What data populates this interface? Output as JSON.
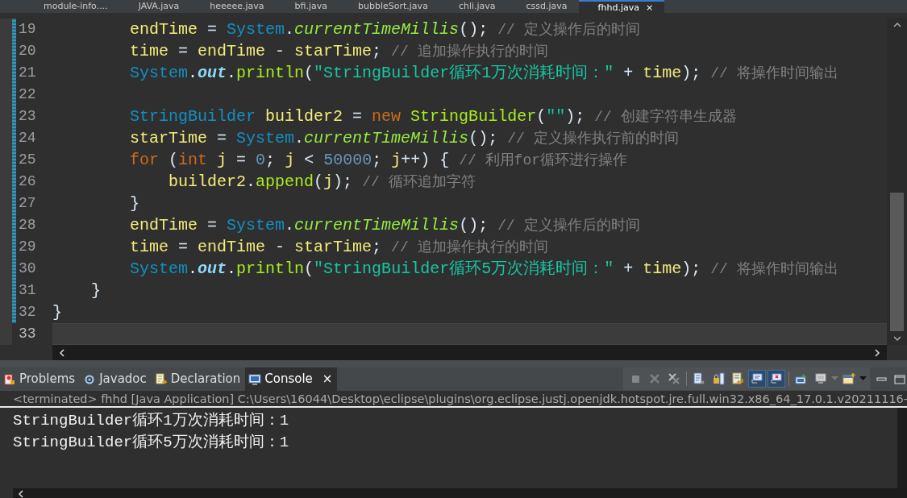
{
  "editor_tabs": [
    {
      "label": "module-info....",
      "selected": false
    },
    {
      "label": "JAVA.java",
      "selected": false
    },
    {
      "label": "heeeee.java",
      "selected": false
    },
    {
      "label": "bfi.java",
      "selected": false
    },
    {
      "label": "bubbleSort.java",
      "selected": false
    },
    {
      "label": "chli.java",
      "selected": false
    },
    {
      "label": "cssd.java",
      "selected": false
    },
    {
      "label": "fhhd.java",
      "selected": true,
      "close": "×"
    }
  ],
  "code_lines": [
    {
      "number": "19",
      "current": false,
      "tokens": [
        {
          "kind": "var",
          "text": "        endTime"
        },
        {
          "kind": "plain",
          "text": " = "
        },
        {
          "kind": "type",
          "text": "System"
        },
        {
          "kind": "plain",
          "text": "."
        },
        {
          "kind": "static",
          "text": "currentTimeMillis"
        },
        {
          "kind": "plain",
          "text": "(); "
        },
        {
          "kind": "comment",
          "text": "// 定义操作后的时间"
        }
      ]
    },
    {
      "number": "20",
      "current": false,
      "tokens": [
        {
          "kind": "var",
          "text": "        time"
        },
        {
          "kind": "plain",
          "text": " = "
        },
        {
          "kind": "var",
          "text": "endTime"
        },
        {
          "kind": "plain",
          "text": " - "
        },
        {
          "kind": "var",
          "text": "starTime"
        },
        {
          "kind": "plain",
          "text": "; "
        },
        {
          "kind": "comment",
          "text": "// 追加操作执行的时间"
        }
      ]
    },
    {
      "number": "21",
      "current": false,
      "tokens": [
        {
          "kind": "type",
          "text": "        System"
        },
        {
          "kind": "plain",
          "text": "."
        },
        {
          "kind": "field",
          "text": "out"
        },
        {
          "kind": "plain",
          "text": "."
        },
        {
          "kind": "method",
          "text": "println"
        },
        {
          "kind": "plain",
          "text": "("
        },
        {
          "kind": "string",
          "text": "\"StringBuilder循环1万次消耗时间：\""
        },
        {
          "kind": "plain",
          "text": " + "
        },
        {
          "kind": "var",
          "text": "time"
        },
        {
          "kind": "plain",
          "text": "); "
        },
        {
          "kind": "comment",
          "text": "// 将操作时间输出"
        }
      ]
    },
    {
      "number": "22",
      "current": false
    },
    {
      "number": "23",
      "current": false,
      "tokens": [
        {
          "kind": "type",
          "text": "        StringBuilder"
        },
        {
          "kind": "var",
          "text": " builder2"
        },
        {
          "kind": "plain",
          "text": " = "
        },
        {
          "kind": "keyword",
          "text": "new"
        },
        {
          "kind": "method",
          "text": " StringBuilder"
        },
        {
          "kind": "plain",
          "text": "("
        },
        {
          "kind": "string",
          "text": "\"\""
        },
        {
          "kind": "plain",
          "text": "); "
        },
        {
          "kind": "comment",
          "text": "// 创建字符串生成器"
        }
      ]
    },
    {
      "number": "24",
      "current": false,
      "tokens": [
        {
          "kind": "var",
          "text": "        starTime"
        },
        {
          "kind": "plain",
          "text": " = "
        },
        {
          "kind": "type",
          "text": "System"
        },
        {
          "kind": "plain",
          "text": "."
        },
        {
          "kind": "static",
          "text": "currentTimeMillis"
        },
        {
          "kind": "plain",
          "text": "(); "
        },
        {
          "kind": "comment",
          "text": "// 定义操作执行前的时间"
        }
      ]
    },
    {
      "number": "25",
      "current": false,
      "tokens": [
        {
          "kind": "keyword",
          "text": "        for"
        },
        {
          "kind": "plain",
          "text": " ("
        },
        {
          "kind": "keyword",
          "text": "int"
        },
        {
          "kind": "var",
          "text": " j"
        },
        {
          "kind": "plain",
          "text": " = "
        },
        {
          "kind": "number",
          "text": "0"
        },
        {
          "kind": "plain",
          "text": "; "
        },
        {
          "kind": "var",
          "text": "j"
        },
        {
          "kind": "plain",
          "text": " < "
        },
        {
          "kind": "number",
          "text": "50000"
        },
        {
          "kind": "plain",
          "text": "; "
        },
        {
          "kind": "var",
          "text": "j"
        },
        {
          "kind": "plain",
          "text": "++) { "
        },
        {
          "kind": "comment",
          "text": "// 利用for循环进行操作"
        }
      ]
    },
    {
      "number": "26",
      "current": false,
      "tokens": [
        {
          "kind": "var",
          "text": "            builder2"
        },
        {
          "kind": "plain",
          "text": "."
        },
        {
          "kind": "method",
          "text": "append"
        },
        {
          "kind": "plain",
          "text": "("
        },
        {
          "kind": "var",
          "text": "j"
        },
        {
          "kind": "plain",
          "text": "); "
        },
        {
          "kind": "comment",
          "text": "// 循环追加字符"
        }
      ]
    },
    {
      "number": "27",
      "current": false,
      "tokens": [
        {
          "kind": "plain",
          "text": "        }"
        }
      ]
    },
    {
      "number": "28",
      "current": false,
      "tokens": [
        {
          "kind": "var",
          "text": "        endTime"
        },
        {
          "kind": "plain",
          "text": " = "
        },
        {
          "kind": "type",
          "text": "System"
        },
        {
          "kind": "plain",
          "text": "."
        },
        {
          "kind": "static",
          "text": "currentTimeMillis"
        },
        {
          "kind": "plain",
          "text": "(); "
        },
        {
          "kind": "comment",
          "text": "// 定义操作后的时间"
        }
      ]
    },
    {
      "number": "29",
      "current": false,
      "tokens": [
        {
          "kind": "var",
          "text": "        time"
        },
        {
          "kind": "plain",
          "text": " = "
        },
        {
          "kind": "var",
          "text": "endTime"
        },
        {
          "kind": "plain",
          "text": " - "
        },
        {
          "kind": "var",
          "text": "starTime"
        },
        {
          "kind": "plain",
          "text": "; "
        },
        {
          "kind": "comment",
          "text": "// 追加操作执行的时间"
        }
      ]
    },
    {
      "number": "30",
      "current": false,
      "tokens": [
        {
          "kind": "type",
          "text": "        System"
        },
        {
          "kind": "plain",
          "text": "."
        },
        {
          "kind": "field",
          "text": "out"
        },
        {
          "kind": "plain",
          "text": "."
        },
        {
          "kind": "method",
          "text": "println"
        },
        {
          "kind": "plain",
          "text": "("
        },
        {
          "kind": "string",
          "text": "\"StringBuilder循环5万次消耗时间：\""
        },
        {
          "kind": "plain",
          "text": " + "
        },
        {
          "kind": "var",
          "text": "time"
        },
        {
          "kind": "plain",
          "text": "); "
        },
        {
          "kind": "comment",
          "text": "// 将操作时间输出"
        }
      ]
    },
    {
      "number": "31",
      "current": false,
      "tokens": [
        {
          "kind": "plain",
          "text": "    }"
        }
      ]
    },
    {
      "number": "32",
      "current": false,
      "tokens": [
        {
          "kind": "plain",
          "text": "}"
        }
      ]
    },
    {
      "number": "33",
      "current": true
    }
  ],
  "panel_tabs": [
    {
      "label": "Problems",
      "kind": "problems",
      "selected": false
    },
    {
      "label": "Javadoc",
      "kind": "javadoc",
      "selected": false
    },
    {
      "label": "Declaration",
      "kind": "declaration",
      "selected": false
    },
    {
      "label": "Console",
      "kind": "console",
      "selected": true,
      "close": "×"
    }
  ],
  "console_toolbar": [
    {
      "kind": "terminate",
      "disabled": true,
      "on": false
    },
    {
      "kind": "remove",
      "disabled": true,
      "on": false
    },
    {
      "kind": "remove-all",
      "disabled": false,
      "on": false
    },
    {
      "kind": "clear",
      "disabled": false,
      "on": false
    },
    {
      "kind": "scroll-lock",
      "disabled": false,
      "on": false
    },
    {
      "kind": "word-wrap",
      "disabled": false,
      "on": false
    },
    {
      "kind": "show-stdout",
      "disabled": false,
      "on": true
    },
    {
      "kind": "show-stderr",
      "disabled": false,
      "on": true
    },
    {
      "kind": "pin",
      "disabled": false,
      "on": false
    },
    {
      "kind": "display",
      "disabled": false,
      "on": false
    },
    {
      "kind": "open-console",
      "disabled": false,
      "on": false
    }
  ],
  "console_status": "<terminated> fhhd [Java Application] C:\\Users\\16044\\Desktop\\eclipse\\plugins\\org.eclipse.justj.openjdk.hotspot.jre.full.win32.x86_64_17.0.1.v20211116-",
  "console_output": [
    "StringBuilder循环1万次消耗时间：1",
    "StringBuilder循环5万次消耗时间：1"
  ]
}
